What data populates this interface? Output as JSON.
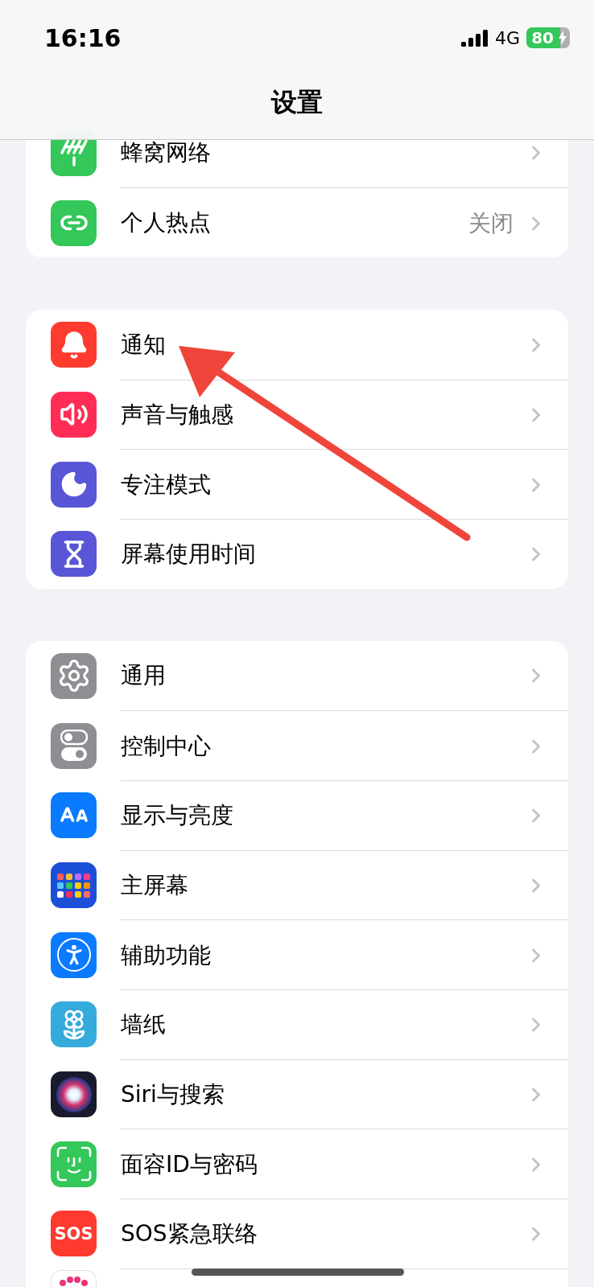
{
  "status_bar": {
    "time": "16:16",
    "network": "4G",
    "battery": "80",
    "charging": true
  },
  "title": "设置",
  "groups": [
    {
      "items": [
        {
          "label": "蜂窝网络",
          "kind": "antenna",
          "color": "#34c759"
        },
        {
          "label": "个人热点",
          "kind": "link",
          "color": "#34c759",
          "value": "关闭"
        }
      ]
    },
    {
      "items": [
        {
          "label": "通知",
          "kind": "bell",
          "color": "#ff3b30"
        },
        {
          "label": "声音与触感",
          "kind": "speaker",
          "color": "#ff2d55"
        },
        {
          "label": "专注模式",
          "kind": "moon",
          "color": "#5856d6"
        },
        {
          "label": "屏幕使用时间",
          "kind": "hourglass",
          "color": "#5856d6"
        }
      ]
    },
    {
      "items": [
        {
          "label": "通用",
          "kind": "gear",
          "color": "#8e8e93"
        },
        {
          "label": "控制中心",
          "kind": "toggles",
          "color": "#8e8e93"
        },
        {
          "label": "显示与亮度",
          "kind": "textsize",
          "color": "#0a7aff"
        },
        {
          "label": "主屏幕",
          "kind": "grid",
          "color": "#1c4fd8"
        },
        {
          "label": "辅助功能",
          "kind": "accessibility",
          "color": "#0a7aff"
        },
        {
          "label": "墙纸",
          "kind": "flower",
          "color": "#35aadc"
        },
        {
          "label": "Siri与搜索",
          "kind": "orb",
          "color": "#1a1a2e"
        },
        {
          "label": "面容ID与密码",
          "kind": "face",
          "color": "#34c759"
        },
        {
          "label": "SOS紧急联络",
          "kind": "badge",
          "badge": "SOS",
          "color": "#ff3b30"
        },
        {
          "kind": "dots",
          "color": "#ffffff"
        }
      ]
    }
  ]
}
